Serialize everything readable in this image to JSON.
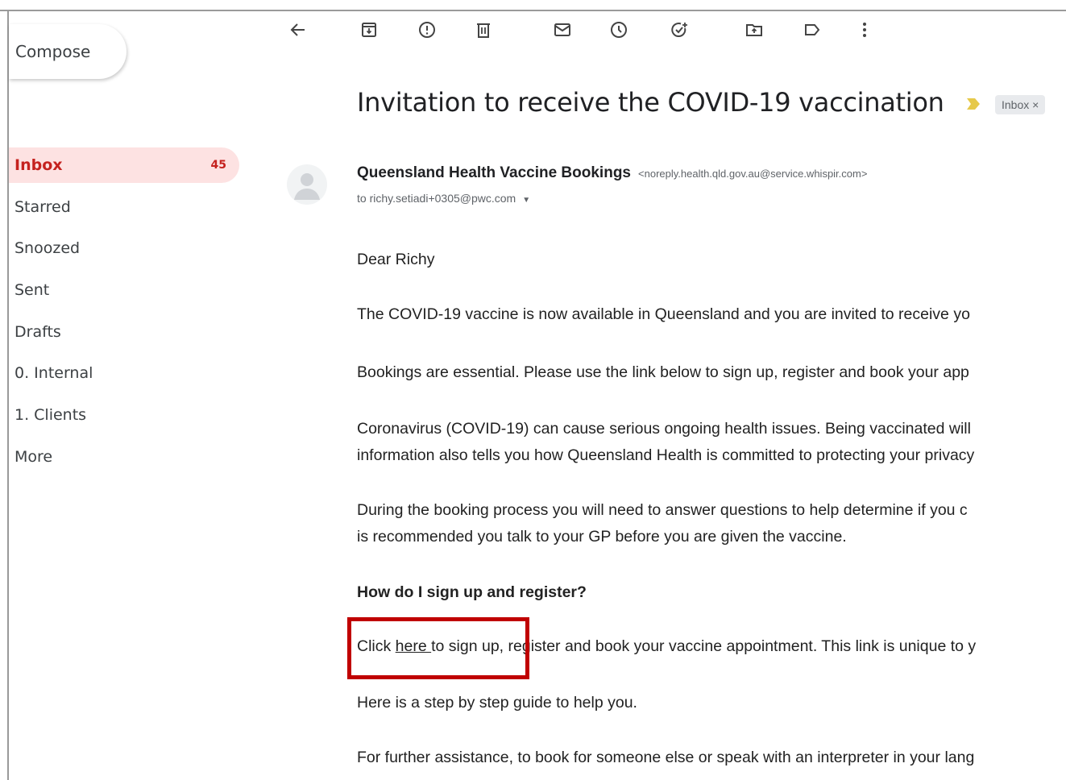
{
  "sidebar": {
    "compose_label": "Compose",
    "items": [
      {
        "label": "Inbox",
        "count": "45"
      },
      {
        "label": "Starred"
      },
      {
        "label": "Snoozed"
      },
      {
        "label": "Sent"
      },
      {
        "label": "Drafts"
      },
      {
        "label": "0. Internal"
      },
      {
        "label": "1. Clients"
      },
      {
        "label": "More"
      }
    ]
  },
  "toolbar": {
    "icons": [
      "back-arrow-icon",
      "archive-icon",
      "report-spam-icon",
      "delete-icon",
      "mark-unread-icon",
      "snooze-icon",
      "add-task-icon",
      "move-to-icon",
      "label-icon",
      "more-vert-icon"
    ]
  },
  "email": {
    "subject": "Invitation to receive the COVID-19 vaccination",
    "label_chip": "Inbox ×",
    "sender_name": "Queensland Health Vaccine Bookings",
    "sender_email": "<noreply.health.qld.gov.au@service.whispir.com>",
    "recipient": "to richy.setiadi+0305@pwc.com",
    "body": {
      "greeting": "Dear Richy",
      "p1": "The COVID-19 vaccine is now available in Queensland and you are invited to receive yo",
      "p2": "Bookings are essential. Please use the link below to sign up, register and book your app",
      "p3_line1": "Coronavirus (COVID-19) can cause serious ongoing health issues. Being vaccinated will",
      "p3_line2": "information also tells you how Queensland Health is committed to protecting your privacy",
      "p4_line1": "During the booking process you will need to answer questions to help determine if you c",
      "p4_line2": "is recommended you talk to your GP before you are given the vaccine.",
      "heading": "How do I sign up and register?",
      "click_prefix": "Click ",
      "click_link": "here ",
      "click_suffix": "to sign up, register and book your vaccine appointment. This link is unique to y",
      "p_guide": "Here is a step by step guide to help you.",
      "p_assist": "For further assistance, to book for someone else or speak with an interpreter in your lang"
    }
  },
  "colors": {
    "active_nav_bg": "#fde2e2",
    "active_nav_text": "#c5221f",
    "highlight_border": "#c00000"
  }
}
